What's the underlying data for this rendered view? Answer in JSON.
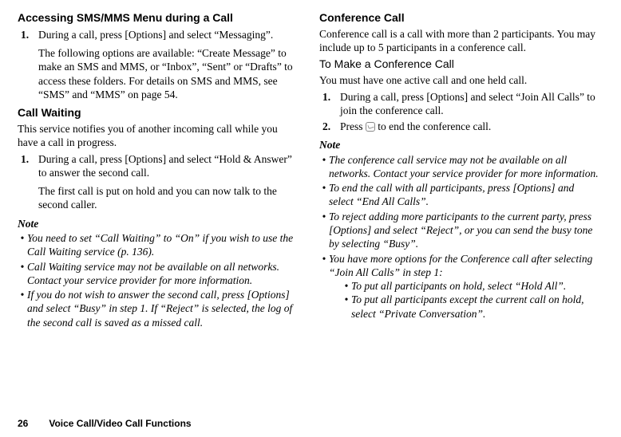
{
  "left": {
    "heading1": "Accessing SMS/MMS Menu during a Call",
    "step1_num": "1.",
    "step1_text": "During a call, press [Options] and select “Messaging”.",
    "step1_follow": "The following options are available: “Create Message” to make an SMS and MMS, or “Inbox”, “Sent” or “Drafts” to access these folders. For details on SMS and MMS, see “SMS” and “MMS” on page 54.",
    "heading2": "Call Waiting",
    "cw_intro": "This service notifies you of another incoming call while you have a call in progress.",
    "cw_step1_num": "1.",
    "cw_step1_text": "During a call, press [Options] and select “Hold & Answer” to answer the second call.",
    "cw_step1_follow": "The first call is put on hold and you can now talk to the second caller.",
    "note_label": "Note",
    "bul1": "You need to set “Call Waiting” to “On” if you wish to use the Call Waiting service (p. 136).",
    "bul2": "Call Waiting service may not be available on all networks. Contact your service provider for more information.",
    "bul3": "If you do not wish to answer the second call, press [Options] and select “Busy” in step 1. If “Reject” is selected, the log of the second call is saved as a missed call."
  },
  "right": {
    "heading1": "Conference Call",
    "cc_intro": "Conference call is a call with more than 2 participants. You may include up to 5 participants in a conference call.",
    "heading2": "To Make a Conference Call",
    "mc_intro": "You must have one active call and one held call.",
    "step1_num": "1.",
    "step1_text": "During a call, press [Options] and select “Join All Calls” to join the conference call.",
    "step2_num": "2.",
    "step2_pre": "Press ",
    "step2_post": " to end the conference call.",
    "note_label": "Note",
    "bul1": "The conference call service may not be available on all networks. Contact your service provider for more information.",
    "bul2": "To end the call with all participants, press [Options] and select “End All Calls”.",
    "bul3": "To reject adding more participants to the current party, press [Options] and select “Reject”, or you can send the busy tone by selecting “Busy”.",
    "bul4": "You have more options for the Conference call after selecting “Join All Calls” in step 1:",
    "sub1": "To put all participants on hold, select “Hold All”.",
    "sub2": "To put all participants except the current call on hold, select “Private Conversation”."
  },
  "footer": {
    "page_num": "26",
    "section": "Voice Call/Video Call Functions"
  }
}
